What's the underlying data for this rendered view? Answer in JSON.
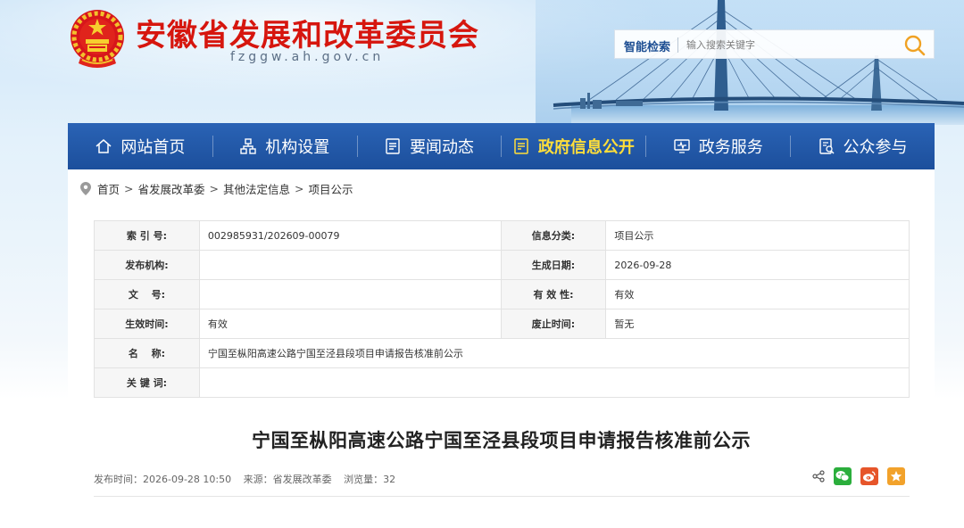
{
  "header": {
    "site_title": "安徽省发展和改革委员会",
    "site_domain": "fzggw.ah.gov.cn",
    "search_label": "智能检索",
    "search_placeholder": "输入搜索关键字"
  },
  "nav": {
    "items": [
      {
        "label": "网站首页",
        "icon": "home-icon"
      },
      {
        "label": "机构设置",
        "icon": "org-chart-icon"
      },
      {
        "label": "要闻动态",
        "icon": "news-icon"
      },
      {
        "label": "政府信息公开",
        "icon": "document-icon",
        "active": true
      },
      {
        "label": "政务服务",
        "icon": "monitor-icon"
      },
      {
        "label": "公众参与",
        "icon": "participation-icon"
      }
    ]
  },
  "breadcrumb": [
    "首页",
    "省发展改革委",
    "其他法定信息",
    "项目公示"
  ],
  "info_table": {
    "index_label": "索 引 号:",
    "index_value": "002985931/202609-00079",
    "category_label": "信息分类:",
    "category_value": "项目公示",
    "publisher_label": "发布机构:",
    "publisher_value": "",
    "created_label": "生成日期:",
    "created_value": "2026-09-28",
    "docno_label": "文　 号:",
    "docno_value": "",
    "validity_label": "有 效 性:",
    "validity_value": "有效",
    "effective_label": "生效时间:",
    "effective_value": "有效",
    "expire_label": "废止时间:",
    "expire_value": "暂无",
    "name_label": "名　 称:",
    "name_value": "宁国至枞阳高速公路宁国至泾县段项目申请报告核准前公示",
    "keywords_label": "关 键 词:",
    "keywords_value": ""
  },
  "article": {
    "title": "宁国至枞阳高速公路宁国至泾县段项目申请报告核准前公示",
    "publish_time": "发布时间：2026-09-28 10:50",
    "source": "来源：省发展改革委",
    "views": "浏览量：32"
  },
  "colors": {
    "brand_red": "#d6160e",
    "nav_blue": "#1f56a6",
    "nav_active": "#ffde3a",
    "wechat": "#2bae3c",
    "weibo": "#e6552a",
    "favorite": "#f2a22b"
  }
}
